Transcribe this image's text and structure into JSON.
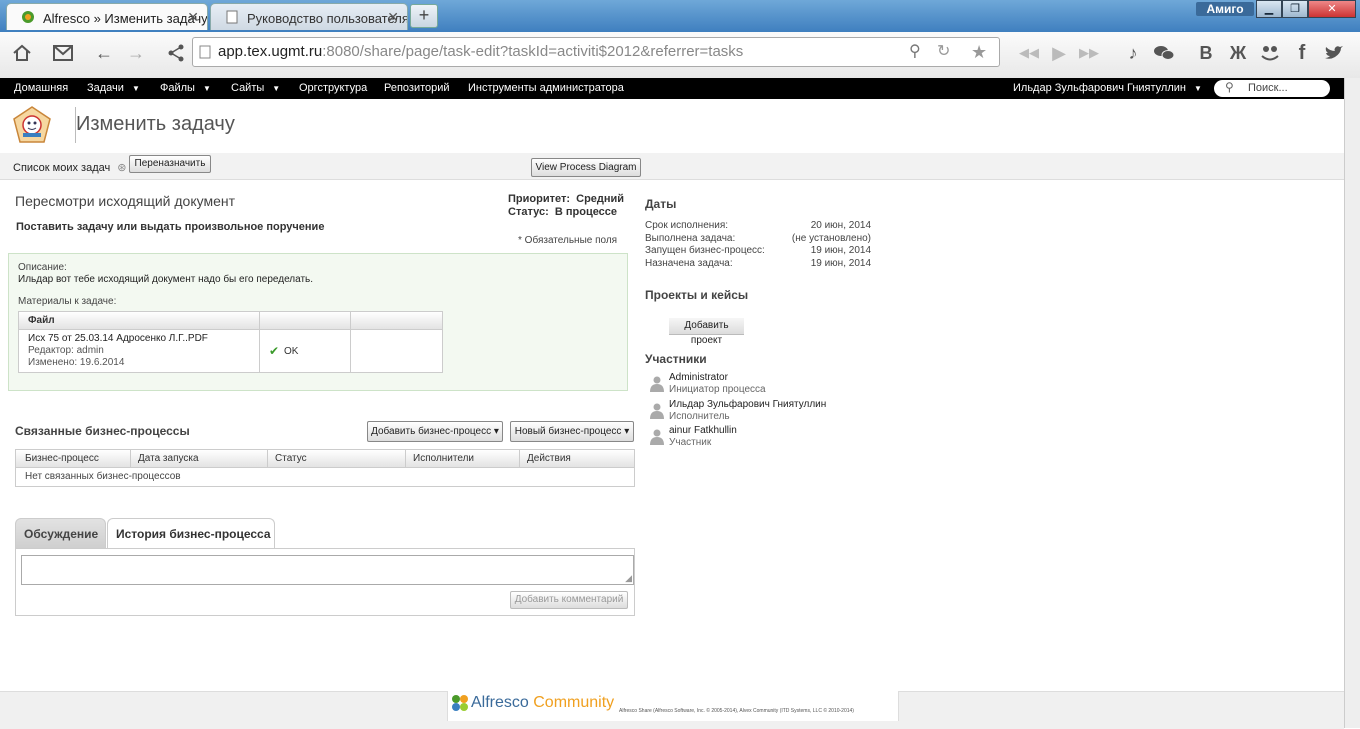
{
  "browser": {
    "tabs": [
      {
        "label": "Alfresco » Изменить задачу",
        "close": "✕"
      },
      {
        "label": "Руководство пользователя",
        "close": "✕"
      }
    ],
    "new_tab": "+",
    "brand": "Амиго",
    "url": {
      "host": "app.tex.ugmt.ru",
      "rest": ":8080/share/page/task-edit?taskId=activiti$2012&referrer=tasks"
    },
    "toolbar_icons": [
      "home-icon",
      "mail-icon",
      "back-icon",
      "forward-icon",
      "share-icon"
    ],
    "social_icons": [
      "music-icon",
      "chat-icon",
      "vk-icon",
      "odnoklassniki-icon",
      "friends-icon",
      "facebook-icon",
      "twitter-icon"
    ],
    "social_labels": {
      "vk": "В",
      "ok": "Ж",
      "fb": "f"
    }
  },
  "app": {
    "nav": {
      "home": "Домашняя",
      "tasks": "Задачи",
      "files": "Файлы",
      "sites": "Сайты",
      "org": "Оргструктура",
      "repo": "Репозиторий",
      "admin": "Инструменты администратора",
      "user": "Ильдар Зульфарович Гниятуллин",
      "search_placeholder": "Поиск..."
    },
    "page_title": "Изменить задачу",
    "subbar": {
      "my_tasks": "Список моих задач",
      "reassign": "Переназначить",
      "view_diagram": "View Process Diagram"
    },
    "task": {
      "title": "Пересмотри исходящий документ",
      "subtitle": "Поставить задачу или выдать произвольное поручение",
      "priority_label": "Приоритет:",
      "priority_value": "Средний",
      "status_label": "Статус:",
      "status_value": "В процессе",
      "required_note": "* Обязательные поля",
      "description_label": "Описание:",
      "description_text": "Ильдар вот тебе исходящий документ надо бы его переделать.",
      "materials_label": "Материалы к задаче:",
      "file_col": "Файл",
      "file": {
        "name": "Исх 75 от 25.03.14 Адросенко Л.Г..PDF",
        "editor": "Редактор: admin",
        "modified": "Изменено: 19.6.2014",
        "state": "OK",
        "check": "✔"
      }
    },
    "related": {
      "title": "Связанные бизнес-процессы",
      "add_btn": "Добавить бизнес-процесс ▾",
      "new_btn": "Новый бизнес-процесс ▾",
      "columns": [
        "Бизнес-процесс",
        "Дата запуска",
        "Статус",
        "Исполнители",
        "Действия"
      ],
      "empty": "Нет связанных бизнес-процессов"
    },
    "discussion": {
      "tab_discussion": "Обсуждение",
      "tab_history": "История бизнес-процесса",
      "add_comment": "Добавить комментарий"
    },
    "dates": {
      "title": "Даты",
      "rows": [
        {
          "label": "Срок исполнения:",
          "value": "20 июн, 2014"
        },
        {
          "label": "Выполнена задача:",
          "value": "(не установлено)"
        },
        {
          "label": "Запущен бизнес-процесс:",
          "value": "19 июн, 2014"
        },
        {
          "label": "Назначена задача:",
          "value": "19 июн, 2014"
        }
      ]
    },
    "projects": {
      "title": "Проекты и кейсы",
      "add_btn": "Добавить проект"
    },
    "participants": {
      "title": "Участники",
      "list": [
        {
          "name": "Administrator",
          "role": "Инициатор процесса"
        },
        {
          "name": "Ильдар Зульфарович Гниятуллин",
          "role": "Исполнитель"
        },
        {
          "name": "ainur Fatkhullin",
          "role": "Участник"
        }
      ]
    },
    "footer": {
      "brand_a": "Alfresco",
      "brand_b": "Community",
      "copyright": "Alfresco Share (Alfresco Software, Inc. © 2005-2014), Alvex Community (ITD Systems, LLC © 2010-2014)"
    }
  },
  "colors": {
    "accent_green": "#4a9a2a",
    "brand_orange": "#f0a020",
    "nav_bg": "#000000"
  }
}
